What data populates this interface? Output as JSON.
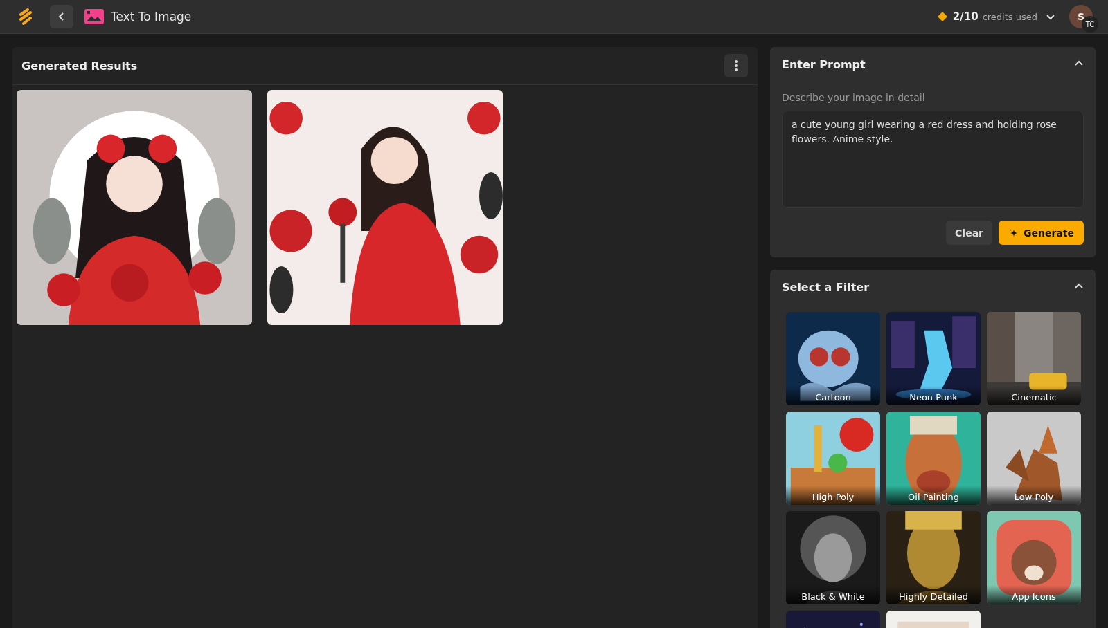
{
  "top_bar": {
    "title": "Text To Image",
    "credits": {
      "count": "2/10",
      "label": "credits used"
    },
    "avatar": {
      "initial": "S",
      "badge": "TC"
    }
  },
  "results": {
    "title": "Generated Results",
    "images": [
      {
        "kind": "picture"
      },
      {
        "kind": "picture"
      }
    ]
  },
  "prompt": {
    "title": "Enter Prompt",
    "expanded": true,
    "label": "Describe your image in detail",
    "value": "a cute young girl wearing a red dress and holding rose flowers. Anime style.",
    "buttons": [
      {
        "label": "Clear",
        "kind": "secondary"
      },
      {
        "label": "Generate",
        "kind": "primary"
      }
    ]
  },
  "filters": {
    "title": "Select a Filter",
    "expanded": true,
    "items": [
      {
        "label": "Cartoon"
      },
      {
        "label": "Neon Punk"
      },
      {
        "label": "Cinematic"
      },
      {
        "label": "High Poly"
      },
      {
        "label": "Oil Painting"
      },
      {
        "label": "Low Poly"
      },
      {
        "label": "Black & White"
      },
      {
        "label": "Highly Detailed"
      },
      {
        "label": "App Icons"
      },
      {
        "kind": "picture"
      },
      {
        "kind": "picture"
      }
    ]
  }
}
